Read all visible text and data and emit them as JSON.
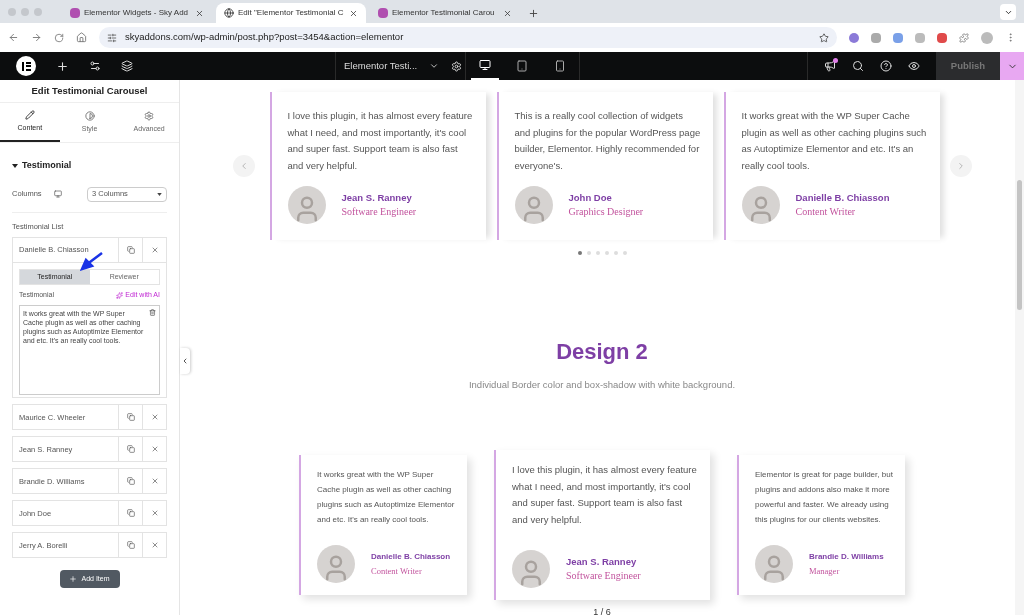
{
  "browser": {
    "tabs": [
      {
        "title": "Elementor Widgets - Sky Add",
        "kind": "site",
        "selected": false
      },
      {
        "title": "Edit \"Elementor Testimonial C",
        "kind": "globe",
        "selected": true
      },
      {
        "title": "Elementor Testimonial Carou",
        "kind": "site",
        "selected": false
      }
    ],
    "url": "skyaddons.com/wp-admin/post.php?post=3454&action=elementor"
  },
  "editor_bar": {
    "document_title": "Elementor Testi...",
    "devices": [
      {
        "kind": "desktop",
        "selected": true
      },
      {
        "kind": "tablet",
        "selected": false
      },
      {
        "kind": "mobile",
        "selected": false
      }
    ],
    "publish": "Publish",
    "notification": true
  },
  "panel": {
    "title": "Edit Testimonial Carousel",
    "tabs": [
      {
        "label": "Content",
        "selected": true
      },
      {
        "label": "Style",
        "selected": false
      },
      {
        "label": "Advanced",
        "selected": false
      }
    ],
    "section": {
      "title": "Testimonial",
      "expanded": true
    },
    "columns": {
      "label": "Columns",
      "value": "3 Columns"
    },
    "list_label": "Testimonial List",
    "items": [
      {
        "name": "Danielle B. Chiasson",
        "expanded": true
      },
      {
        "name": "Maurice C. Wheeler",
        "expanded": false
      },
      {
        "name": "Jean S. Ranney",
        "expanded": false
      },
      {
        "name": "Brandie D. Williams",
        "expanded": false
      },
      {
        "name": "John Doe",
        "expanded": false
      },
      {
        "name": "Jerry A. Borelli",
        "expanded": false
      }
    ],
    "item_tabs": [
      {
        "label": "Testimonial",
        "selected": true
      },
      {
        "label": "Reviewer",
        "selected": false
      }
    ],
    "field_label": "Testimonial",
    "ai_button": "Edit with AI",
    "field_value": "It works great with the WP Super Cache plugin as well as other caching plugins such as Autoptimize Elementor and etc. It's an really cool tools.",
    "add_button": "Add Item"
  },
  "canvas": {
    "carousel": [
      {
        "text": "I love this plugin, it has almost every feature what I need, and most importantly, it's cool and super fast. Support team is also fast and very helpful.",
        "name": "Jean S. Ranney",
        "role": "Software Engineer"
      },
      {
        "text": "This is a really cool collection of widgets and plugins for the popular WordPress page builder, Elementor. Highly recommended for everyone's.",
        "name": "John Doe",
        "role": "Graphics Designer"
      },
      {
        "text": "It works great with the WP Super Cache plugin as well as other caching plugins such as Autoptimize Elementor and etc. It's an really cool tools.",
        "name": "Danielle B. Chiasson",
        "role": "Content Writer"
      }
    ],
    "dots": [
      {
        "selected": true
      },
      {
        "selected": false
      },
      {
        "selected": false
      },
      {
        "selected": false
      },
      {
        "selected": false
      },
      {
        "selected": false
      }
    ],
    "heading": "Design 2",
    "subtitle": "Individual Border color and box-shadow with white background.",
    "carousel_2": [
      {
        "kind": "side",
        "text": "It works great with the WP Super Cache plugin as well as other caching plugins such as Autoptimize Elementor and etc. It's an really cool tools.",
        "name": "Danielle B. Chiasson",
        "role": "Content Writer"
      },
      {
        "kind": "center",
        "text": "I love this plugin, it has almost every feature what I need, and most importantly, it's cool and super fast. Support team is also fast and very helpful.",
        "name": "Jean S. Ranney",
        "role": "Software Engineer"
      },
      {
        "kind": "side",
        "text": "Elementor is great for page builder, but plugins and addons also make it more powerful and faster. We already using this plugins for our clients websites.",
        "name": "Brandie D. Williams",
        "role": "Manager"
      }
    ],
    "pager": "1 / 6"
  }
}
